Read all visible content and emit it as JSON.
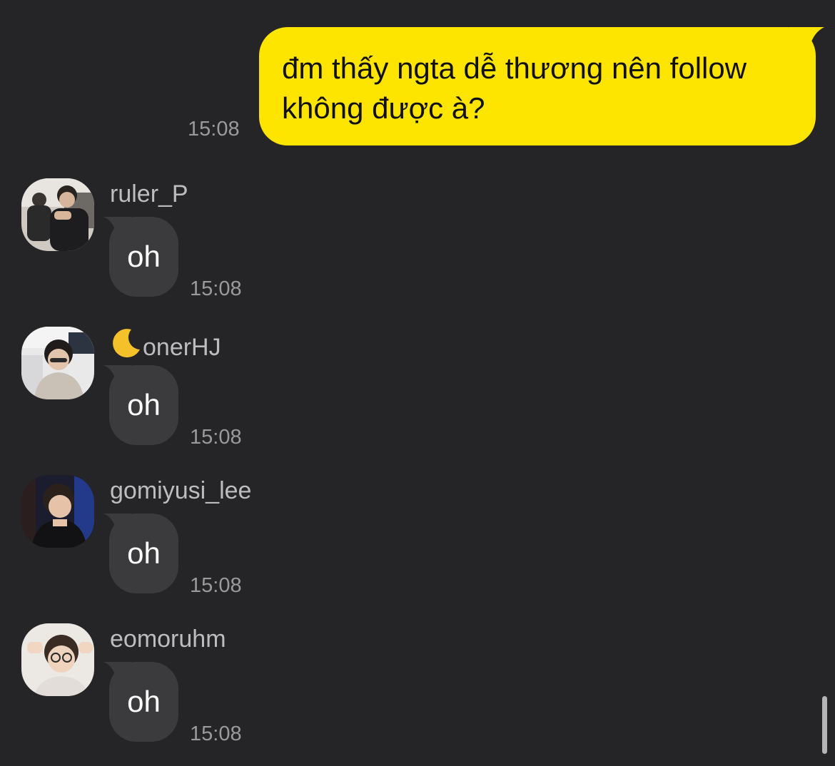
{
  "outgoing": {
    "line1": "đm thấy ngta dễ thương nên follow",
    "line2": "không được à?",
    "time": "15:08",
    "bubble_color": "#FEE500"
  },
  "incoming": [
    {
      "sender": "ruler_P",
      "text": "oh",
      "time": "15:08",
      "avatar": "avatar-photo"
    },
    {
      "sender": "onerHJ",
      "sender_prefix_icon": "crescent-moon-icon",
      "text": "oh",
      "time": "15:08",
      "avatar": "avatar-photo"
    },
    {
      "sender": "gomiyusi_lee",
      "text": "oh",
      "time": "15:08",
      "avatar": "avatar-photo"
    },
    {
      "sender": "eomoruhm",
      "text": "oh",
      "time": "15:08",
      "avatar": "avatar-photo"
    }
  ],
  "theme": {
    "background": "#252527",
    "incoming_bubble": "#3B3B3D",
    "timestamp": "#9A9A9D"
  }
}
